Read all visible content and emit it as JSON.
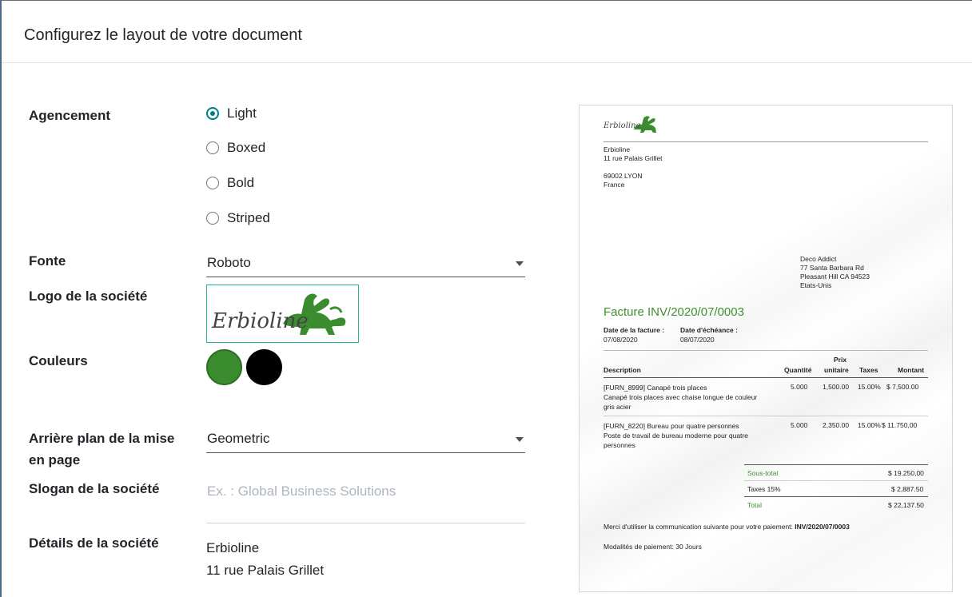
{
  "dialog": {
    "title": "Configurez le layout de votre document"
  },
  "form": {
    "agencement": {
      "label": "Agencement",
      "options": [
        "Light",
        "Boxed",
        "Bold",
        "Striped"
      ],
      "selected": "Light"
    },
    "fonte": {
      "label": "Fonte",
      "value": "Roboto"
    },
    "logo": {
      "label": "Logo de la société",
      "text": "Erbioline"
    },
    "couleurs": {
      "label": "Couleurs",
      "primary": "#3a8c2f",
      "secondary": "#000000"
    },
    "arriere_plan": {
      "label_line1": "Arrière plan de la mise",
      "label_line2": "en page",
      "value": "Geometric"
    },
    "slogan": {
      "label": "Slogan de la société",
      "placeholder": "Ex. : Global Business Solutions"
    },
    "details": {
      "label": "Détails de la société",
      "lines": [
        "Erbioline",
        "11 rue Palais Grillet"
      ]
    }
  },
  "preview": {
    "logo_text": "Erbioline",
    "company_lines": [
      "Erbioline",
      "11 rue Palais Grillet",
      "",
      "69002 LYON",
      "France"
    ],
    "customer_lines": [
      "Deco Addict",
      "77 Santa Barbara Rd",
      "Pleasant Hill CA 94523",
      "Etats-Unis"
    ],
    "invoice_title": "Facture INV/2020/07/0003",
    "date_label": "Date de la facture :",
    "date_value": "07/08/2020",
    "due_label": "Date d'échéance :",
    "due_value": "08/07/2020",
    "columns": {
      "description": "Description",
      "quantity": "Quantité",
      "price_top": "Prix",
      "price_bottom": "unitaire",
      "taxes": "Taxes",
      "amount": "Montant"
    },
    "lines": [
      {
        "desc": [
          "[FURN_8999] Canapé trois places",
          "Canapé trois places avec chaise longue de couleur",
          "gris acier"
        ],
        "qty": "5.000",
        "price": "1,500.00",
        "tax": "15.00%",
        "amount": "$ 7,500.00"
      },
      {
        "desc": [
          "[FURN_8220] Bureau pour quatre personnes",
          "Poste de travail de bureau moderne pour quatre",
          "personnes"
        ],
        "qty": "5.000",
        "price": "2,350.00",
        "tax": "15.00%",
        "amount": "$ 11.750,00"
      }
    ],
    "totals": {
      "subtotal_label": "Sous-total",
      "subtotal_value": "$ 19.250,00",
      "tax_label": "Taxes 15%",
      "tax_value": "$ 2,887.50",
      "total_label": "Total",
      "total_value": "$ 22,137.50"
    },
    "payment_comm_prefix": "Merci d'utiliser la communication suivante pour votre paiement:",
    "payment_comm_ref": "INV/2020/07/0003",
    "payment_terms": "Modalités de paiement: 30 Jours"
  }
}
